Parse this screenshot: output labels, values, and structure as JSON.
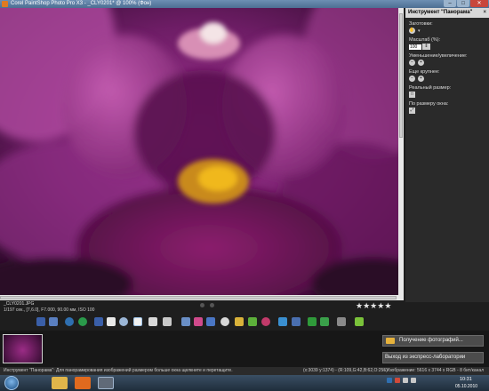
{
  "window": {
    "title": "Corel PaintShop Photo Pro X3 - _CLY0201* @ 100% (Фон)",
    "minimize": "–",
    "maximize": "□",
    "close": "✕"
  },
  "panel": {
    "header": "Инструмент \"Панорама\"",
    "close": "×",
    "presets_label": "Заготовки:",
    "zoom_label": "Масштаб (%):",
    "zoom_value": "100",
    "zoom_in_out_label": "Уменьшение/увеличение:",
    "zoom_more_label": "Еще крупнее:",
    "actual_size_label": "Реальный размер:",
    "fit_window_label": "По размеру окна:"
  },
  "photo_info": {
    "filename": "_CLY0201.JPG",
    "exif": "1/197 сек., [7,6.0], F7.000, 90.00 мм, ISO 100"
  },
  "rating": [
    "★",
    "★",
    "★",
    "★",
    "★"
  ],
  "actions": {
    "get_photos": "Получение фотографий...",
    "exit_express": "Выход из экспресс-лаборатории"
  },
  "status": {
    "message": "Инструмент \"Панорама\": Для панорамирования изображений размером больше окна щелкните и перетащите.",
    "coords": "(x:3039 y:1374) - (R:109,G:42,B:62,O:255)",
    "image_info": "-- Изображение: 5616 x 3744 x RGB - 8 бит/канал"
  },
  "clock": {
    "time": "10:31",
    "date": "05.10.2010"
  },
  "colors": {
    "flower_dark": "#3a0c35",
    "flower_mid": "#8a2b7d",
    "flower_light": "#c25aa9",
    "stamen": "#e0a418",
    "column": "#f2d9dc"
  },
  "icons": {
    "toolbar": [
      "save-icon",
      "save-as-icon",
      "undo-icon",
      "redo-icon",
      "fit-window-icon",
      "actual-size-icon",
      "zoom-icon",
      "pan-icon",
      "select-icon",
      "crop-icon",
      "smart-photo-fix-icon",
      "color-balance-icon",
      "brightness-icon",
      "sharpen-icon",
      "paint-brush-icon",
      "red-eye-icon",
      "clone-icon",
      "retouch-icon",
      "rotate-left-icon",
      "rotate-right-icon",
      "delete-icon",
      "effects-icon"
    ]
  }
}
